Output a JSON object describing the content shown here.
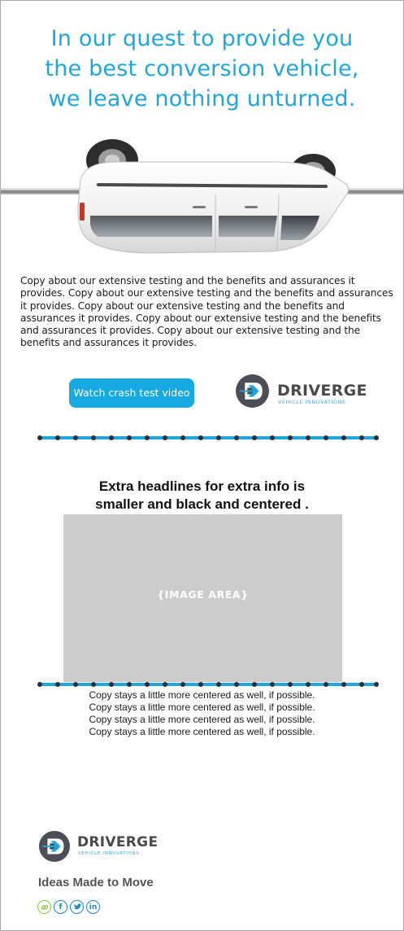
{
  "hero": {
    "headline_lines": [
      "In our quest to provide you",
      "the best conversion vehicle,",
      "we leave nothing unturned."
    ]
  },
  "intro": {
    "copy": "Copy about our extensive testing and the benefits and assurances it provides. Copy about our extensive testing and the benefits and assurances it provides.  Copy about our extensive testing and the benefits and assurances it provides.  Copy about our extensive testing and the benefits and assurances it provides.  Copy about our extensive testing and the benefits and assurances it provides."
  },
  "cta": {
    "label": "Watch crash test video"
  },
  "brand": {
    "name": "DRIVERGE",
    "tagline": "VEHICLE INNOVATIONS",
    "primary_color": "#1ea6dd",
    "text_color": "#4a4a4a"
  },
  "section": {
    "headline_lines": [
      "Extra headlines for extra info is",
      "smaller and black and centered ."
    ],
    "image_placeholder": "{IMAGE AREA}",
    "copy_lines": [
      "Copy stays a little more centered as well, if possible.",
      "Copy stays a little more centered as well, if possible.",
      "Copy stays a little more centered as well, if possible.",
      "Copy stays a little more centered as well, if possible."
    ]
  },
  "footer": {
    "tagline": "Ideas Made to Move",
    "social": [
      {
        "icon": "link-icon",
        "glyph": ""
      },
      {
        "icon": "facebook-icon",
        "glyph": "f"
      },
      {
        "icon": "twitter-icon",
        "glyph": ""
      },
      {
        "icon": "linkedin-icon",
        "glyph": "in"
      }
    ]
  },
  "colors": {
    "accent_blue": "#1ea6dd",
    "divider_dot": "#2b2f36",
    "placeholder_gray": "#cccccc"
  }
}
